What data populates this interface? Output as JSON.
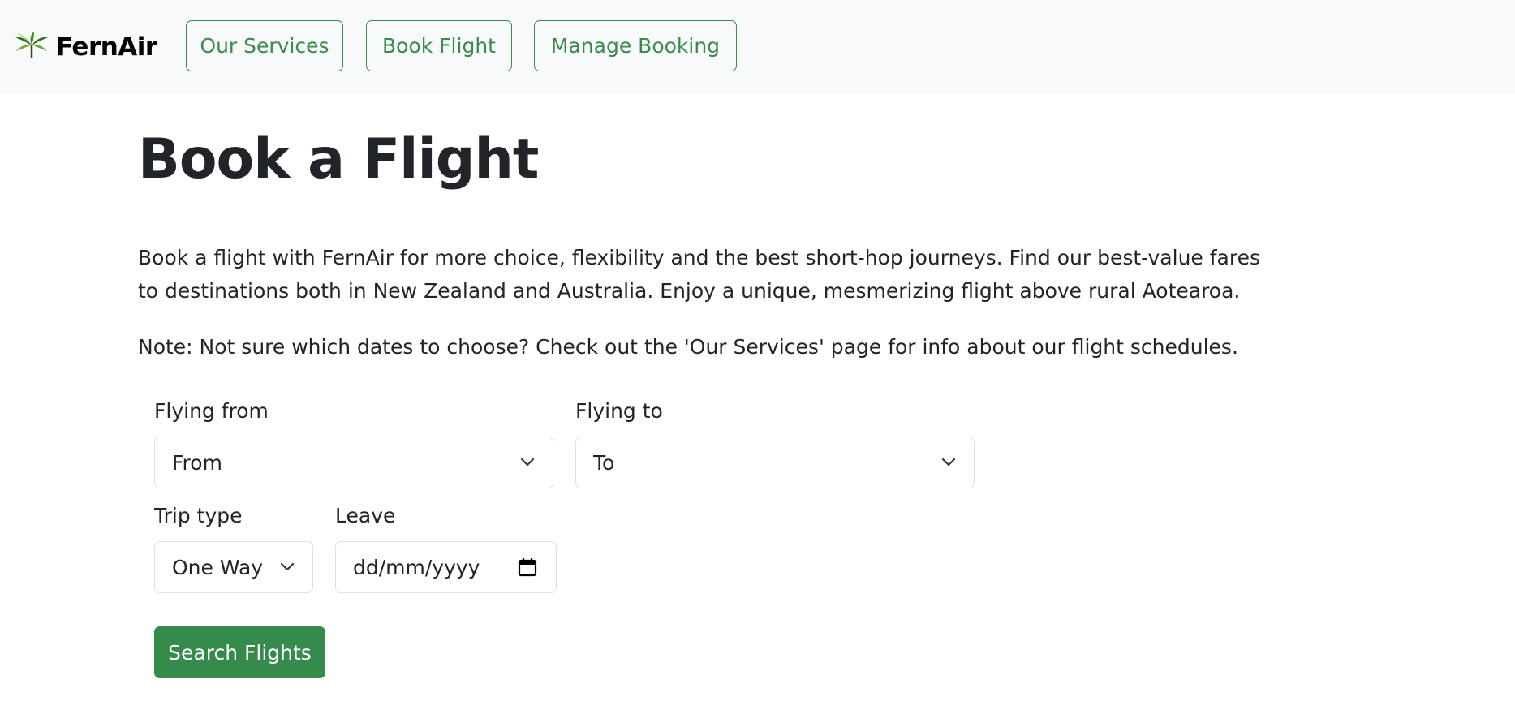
{
  "brand": {
    "name": "FernAir",
    "logo": "fern-logo-icon"
  },
  "nav": {
    "services_label": "Our Services",
    "book_label": "Book Flight",
    "manage_label": "Manage Booking"
  },
  "page": {
    "title": "Book a Flight",
    "intro": "Book a flight with FernAir for more choice, flexibility and the best short-hop journeys. Find our best-value fares to destinations both in New Zealand and Australia. Enjoy a unique, mesmerizing flight above rural Aotearoa.",
    "note": "Note: Not sure which dates to choose? Check out the 'Our Services' page for info about our flight schedules."
  },
  "form": {
    "from_label": "Flying from",
    "from_value": "From",
    "to_label": "Flying to",
    "to_value": "To",
    "trip_label": "Trip type",
    "trip_value": "One Way",
    "leave_label": "Leave",
    "leave_placeholder": "dd/mm/yyyy",
    "search_label": "Search Flights"
  },
  "colors": {
    "accent": "#3a8a49",
    "button_fill": "#358a4c",
    "navbar_bg": "#f8f9fa"
  },
  "icons": {
    "select_arrow": "chevron-down-icon",
    "date_picker": "calendar-icon"
  }
}
